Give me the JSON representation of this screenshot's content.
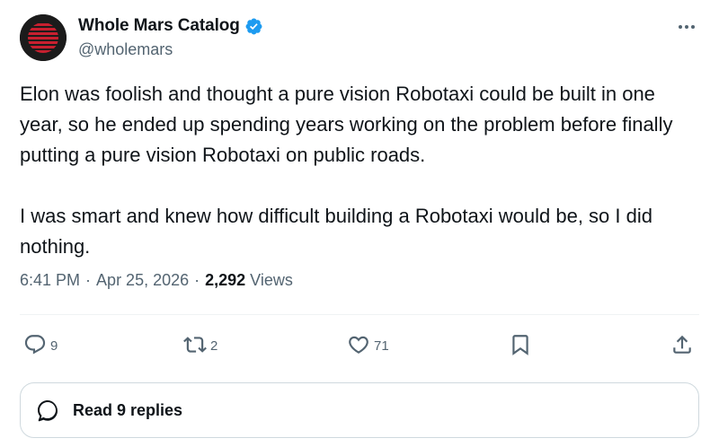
{
  "author": {
    "display_name": "Whole Mars Catalog",
    "handle": "@wholemars",
    "verified": true,
    "avatar_icon": "striped-red-sphere-icon",
    "avatar_colors": {
      "background": "#1b1b1b",
      "stripes": "#c8202f"
    }
  },
  "tweet": {
    "text": "Elon was foolish and thought a pure vision Robotaxi could be built in one year, so he ended up spending years working on the problem before finally putting a pure vision Robotaxi on public roads.\n\nI was smart and knew how difficult building a Robotaxi would be, so I did nothing."
  },
  "meta": {
    "time": "6:41 PM",
    "date": "Apr 25, 2026",
    "separator": "·",
    "views_count": "2,292",
    "views_label": "Views"
  },
  "actions": {
    "replies": "9",
    "retweets": "2",
    "likes": "71",
    "icons": [
      "reply-icon",
      "retweet-icon",
      "like-icon",
      "bookmark-icon",
      "share-icon"
    ]
  },
  "read_replies": {
    "label": "Read 9 replies",
    "icon": "speech-bubble-icon"
  },
  "colors": {
    "text": "#0f1419",
    "secondary": "#536471",
    "verified_blue": "#1d9bf0",
    "border": "#cfd9de"
  }
}
